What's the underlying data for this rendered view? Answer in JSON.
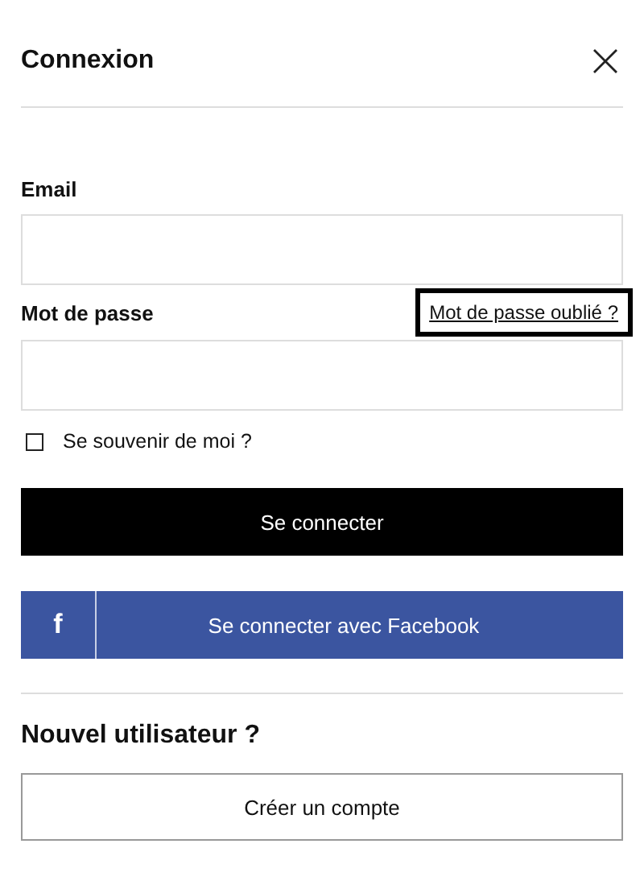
{
  "dialog": {
    "title": "Connexion"
  },
  "email": {
    "label": "Email"
  },
  "password": {
    "label": "Mot de passe",
    "forgot_link": "Mot de passe oublié ?",
    "forgot_focused": true
  },
  "remember": {
    "label": "Se souvenir de moi ?",
    "checked": false
  },
  "login_button": "Se connecter",
  "facebook_button": {
    "icon": "f",
    "label": "Se connecter avec Facebook"
  },
  "new_user": {
    "title": "Nouvel utilisateur ?",
    "button": "Créer un compte"
  }
}
